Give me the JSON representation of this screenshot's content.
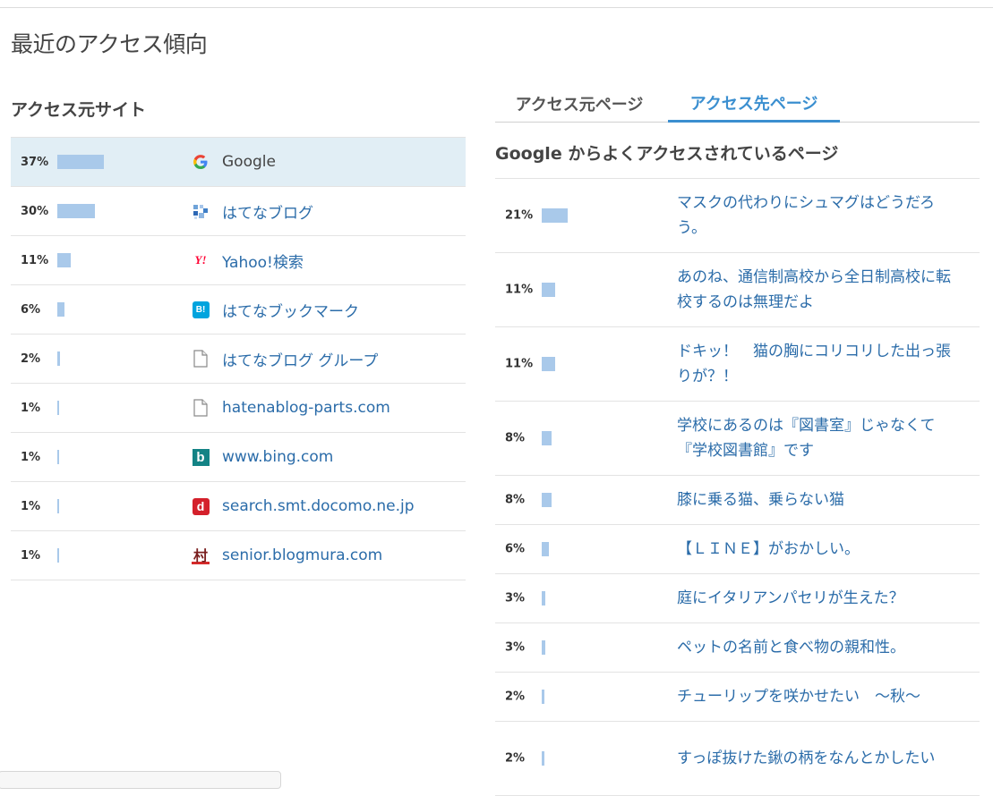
{
  "page": {
    "title": "最近のアクセス傾向"
  },
  "sources": {
    "heading": "アクセス元サイト",
    "rows": [
      {
        "percent": "37%",
        "share": 37,
        "name": "Google",
        "icon": "google-icon"
      },
      {
        "percent": "30%",
        "share": 30,
        "name": "はてなブログ",
        "icon": "hatena-blog-icon"
      },
      {
        "percent": "11%",
        "share": 11,
        "name": "Yahoo!検索",
        "icon": "yahoo-icon",
        "icon_text": "Y!"
      },
      {
        "percent": "6%",
        "share": 6,
        "name": "はてなブックマーク",
        "icon": "hatena-bookmark-icon",
        "icon_text": "B!"
      },
      {
        "percent": "2%",
        "share": 2,
        "name": "はてなブログ グループ",
        "icon": "page-icon"
      },
      {
        "percent": "1%",
        "share": 1,
        "name": "hatenablog-parts.com",
        "icon": "page-icon"
      },
      {
        "percent": "1%",
        "share": 1,
        "name": "www.bing.com",
        "icon": "bing-icon",
        "icon_text": "b"
      },
      {
        "percent": "1%",
        "share": 1,
        "name": "search.smt.docomo.ne.jp",
        "icon": "docomo-icon",
        "icon_text": "d"
      },
      {
        "percent": "1%",
        "share": 1,
        "name": "senior.blogmura.com",
        "icon": "blogmura-icon",
        "icon_text": "村"
      }
    ]
  },
  "tabs": {
    "source_pages": "アクセス元ページ",
    "destination_pages": "アクセス先ページ"
  },
  "destinations": {
    "heading": "Google からよくアクセスされているページ",
    "rows": [
      {
        "percent": "21%",
        "share": 21,
        "title": "マスクの代わりにシュマグはどうだろう。"
      },
      {
        "percent": "11%",
        "share": 11,
        "title": "あのね、通信制高校から全日制高校に転校するのは無理だよ"
      },
      {
        "percent": "11%",
        "share": 11,
        "title": "ドキッ！　猫の胸にコリコリした出っ張りが？！"
      },
      {
        "percent": "8%",
        "share": 8,
        "title": "学校にあるのは『図書室』じゃなくて『学校図書館』です"
      },
      {
        "percent": "8%",
        "share": 8,
        "title": "膝に乗る猫、乗らない猫"
      },
      {
        "percent": "6%",
        "share": 6,
        "title": "【ＬＩＮＥ】がおかしい。"
      },
      {
        "percent": "3%",
        "share": 3,
        "title": "庭にイタリアンパセリが生えた？"
      },
      {
        "percent": "3%",
        "share": 3,
        "title": "ペットの名前と食べ物の親和性。"
      },
      {
        "percent": "2%",
        "share": 2,
        "title": "チューリップを咲かせたい　～秋～"
      },
      {
        "percent": "2%",
        "share": 2,
        "title": "すっぽ抜けた鍬の柄をなんとかしたい"
      }
    ]
  },
  "colors": {
    "bar": "#a9c9ea",
    "link": "#2b6ca9",
    "tab_active": "#3b8fd0",
    "row_highlight": "#e1eef5"
  }
}
